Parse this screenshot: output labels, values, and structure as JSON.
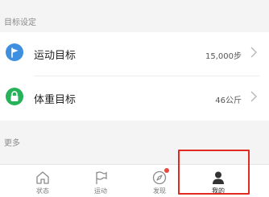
{
  "sections": {
    "goals_header": "目标设定",
    "more_header": "更多"
  },
  "goals": [
    {
      "title": "运动目标",
      "value": "15,000步",
      "icon": "flag-icon",
      "color": "#3f8fe0"
    },
    {
      "title": "体重目标",
      "value": "46公斤",
      "icon": "lock-icon",
      "color": "#27b15a"
    }
  ],
  "tabbar": {
    "tabs": [
      {
        "label": "状态",
        "icon": "home-icon"
      },
      {
        "label": "运动",
        "icon": "flag-outline-icon"
      },
      {
        "label": "发现",
        "icon": "compass-icon"
      },
      {
        "label": "我的",
        "icon": "person-icon",
        "active": true
      }
    ],
    "badge_color": "#e64a3c",
    "highlight_color": "#e02a22"
  }
}
